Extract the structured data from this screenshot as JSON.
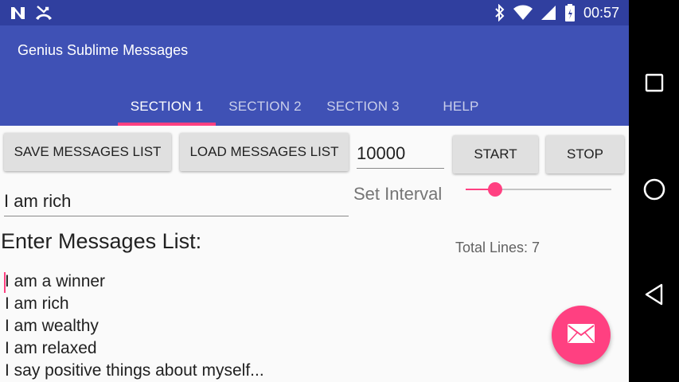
{
  "status_bar": {
    "left_icons": [
      "n-notification-icon",
      "missed-call-icon"
    ],
    "right_icons": [
      "bluetooth-icon",
      "wifi-icon",
      "cell-signal-icon",
      "battery-icon"
    ],
    "time": "00:57"
  },
  "app": {
    "title": "Genius Sublime Messages",
    "accent_color": "#ff4081",
    "primary_color": "#3f51b5"
  },
  "tabs": [
    {
      "label": "SECTION 1",
      "active": true
    },
    {
      "label": "SECTION 2",
      "active": false
    },
    {
      "label": "SECTION 3",
      "active": false
    },
    {
      "label": "HELP",
      "active": false
    }
  ],
  "toolbar": {
    "save_label": "SAVE MESSAGES LIST",
    "load_label": "LOAD MESSAGES LIST",
    "interval_value": "10000",
    "start_label": "START",
    "stop_label": "STOP"
  },
  "current_message": "I am rich",
  "interval": {
    "label": "Set Interval",
    "slider_fraction": 0.2
  },
  "messages": {
    "heading": "Enter Messages List:",
    "total_lines_label": "Total Lines: 7",
    "lines": [
      "I am a winner",
      "I am rich",
      "I am wealthy",
      "I am relaxed",
      "I say positive things about myself..."
    ]
  },
  "fab": {
    "icon": "envelope-icon"
  },
  "nav_bar": {
    "icons": [
      "recents-square-icon",
      "home-circle-icon",
      "back-triangle-icon"
    ]
  }
}
